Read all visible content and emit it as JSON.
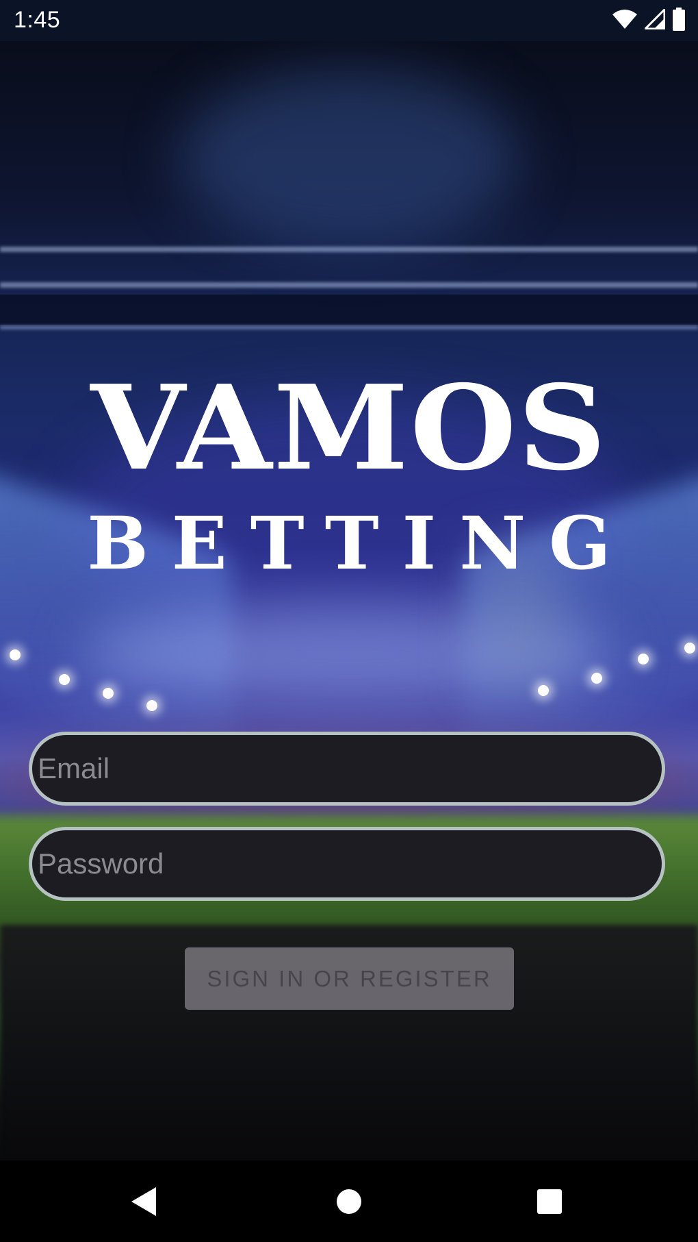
{
  "status_bar": {
    "time": "1:45",
    "icons": [
      "wifi-icon",
      "signal-icon",
      "battery-icon"
    ]
  },
  "logo": {
    "line1": "VAMOS",
    "line2": "BETTING"
  },
  "form": {
    "email_placeholder": "Email",
    "email_value": "",
    "password_placeholder": "Password",
    "password_value": "",
    "submit_label": "SIGN IN OR REGISTER"
  },
  "nav_bar": {
    "buttons": [
      "back-icon",
      "home-icon",
      "recents-icon"
    ]
  },
  "colors": {
    "status_bar_bg": "#0b1426",
    "field_bg": "#1e1c23",
    "field_border": "#b6c1c1",
    "placeholder_text": "#8b8b91",
    "button_bg": "#807c84",
    "button_text": "#47454b",
    "nav_bar_bg": "#000000"
  }
}
